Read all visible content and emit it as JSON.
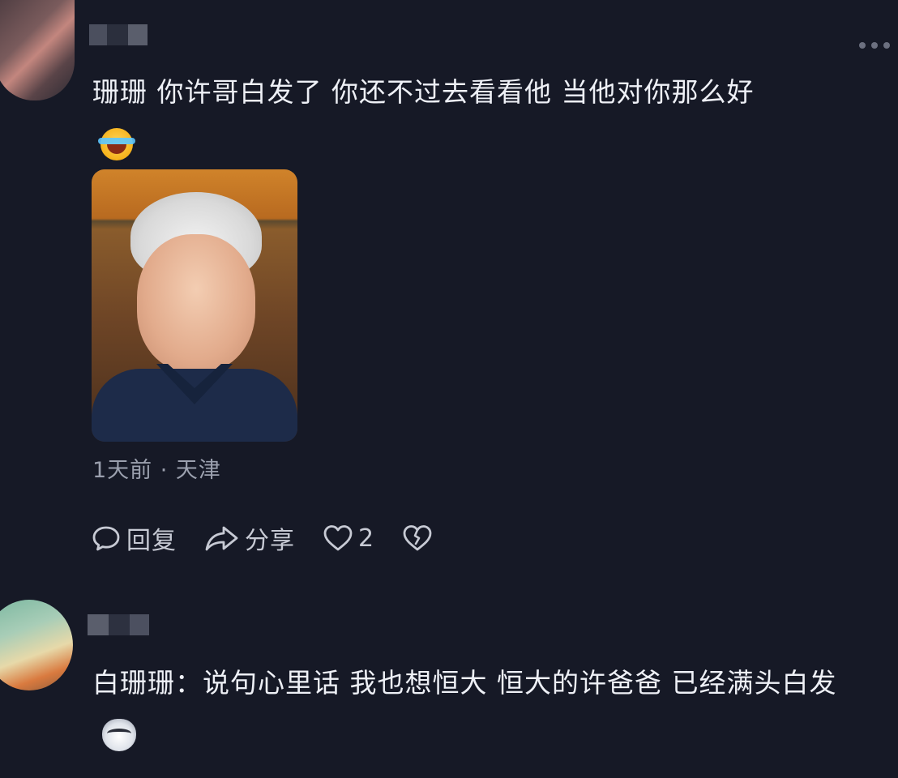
{
  "comments": [
    {
      "text": "珊珊 你许哥白发了 你还不过去看看他 当他对你那么好",
      "emoji": "laughing-crying-emoji",
      "image": "gray-haired-man-photo",
      "meta": "1天前 · 天津",
      "actions": {
        "reply_label": "回复",
        "share_label": "分享",
        "like_count": "2"
      }
    },
    {
      "text": "白珊珊：说句心里话 我也想恒大 恒大的许爸爸 已经满头白发",
      "emoji": "cat-emoji"
    }
  ],
  "colors": {
    "background": "#161926",
    "text": "#eef0f6",
    "meta": "#9ba0ae"
  }
}
